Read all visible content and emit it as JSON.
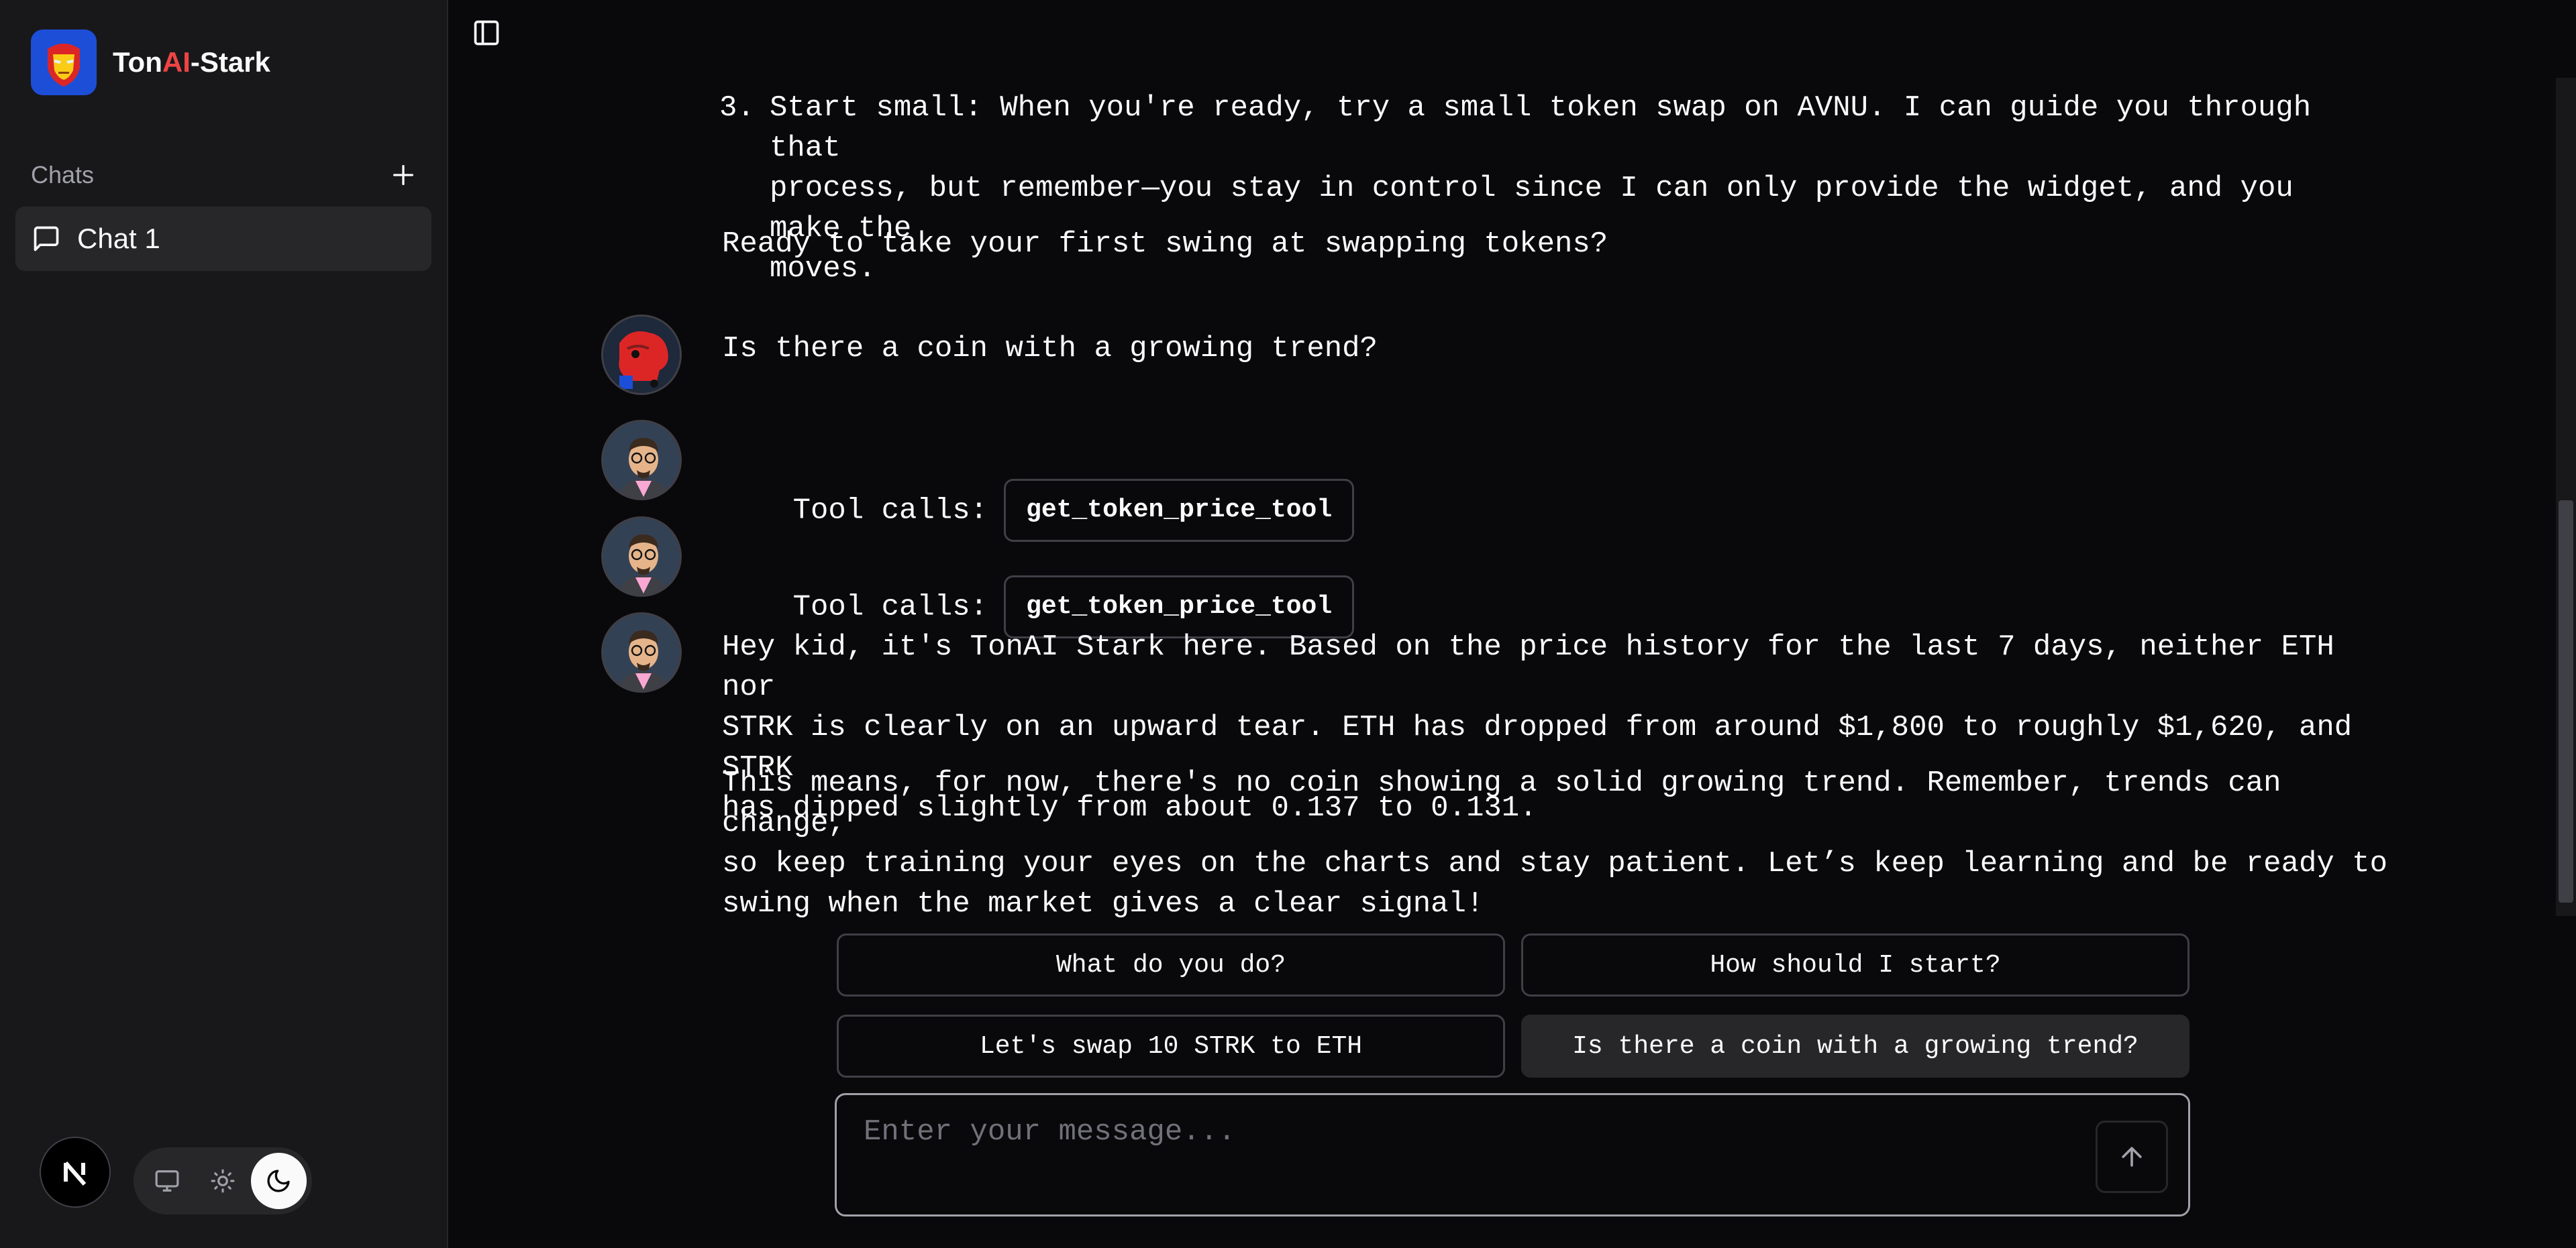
{
  "app": {
    "brand_prefix": "Ton",
    "brand_ai": "AI",
    "brand_suffix": "-Stark"
  },
  "sidebar": {
    "chats_label": "Chats",
    "items": [
      {
        "label": "Chat 1"
      }
    ]
  },
  "messages": {
    "list_item_number": "3.",
    "list_item_text": "Start small: When you're ready, try a small token swap on AVNU. I can guide you through that\nprocess, but remember—you stay in control since I can only provide the widget, and you make the\nmoves.",
    "ready_text": "Ready to take your first swing at swapping tokens?",
    "user_question": "Is there a coin with a growing trend?",
    "tool_calls_label_1": "Tool calls:",
    "tool_name_1": "get_token_price_tool",
    "tool_calls_label_2": "Tool calls:",
    "tool_name_2": "get_token_price_tool",
    "answer_p1": "Hey kid, it's TonAI Stark here. Based on the price history for the last 7 days, neither ETH nor\nSTRK is clearly on an upward tear. ETH has dropped from around $1,800 to roughly $1,620, and STRK\nhas dipped slightly from about 0.137 to 0.131.",
    "answer_p2": "This means, for now, there's no coin showing a solid growing trend. Remember, trends can change,\nso keep training your eyes on the charts and stay patient. Let’s keep learning and be ready to\nswing when the market gives a clear signal!"
  },
  "suggestions": [
    {
      "label": "What do you do?"
    },
    {
      "label": "How should I start?"
    },
    {
      "label": "Let's swap 10 STRK to ETH"
    },
    {
      "label": "Is there a coin with a growing trend?"
    }
  ],
  "composer": {
    "placeholder": "Enter your message..."
  },
  "colors": {
    "accent_ai": "#ef4444",
    "logo_bg": "#1d4ed8",
    "bg": "#09090b",
    "sidebar_bg": "#18181b"
  },
  "icons": {
    "sidebar_toggle": "panel-left-icon",
    "new_chat": "plus-icon",
    "chat": "message-square-icon",
    "send": "arrow-up-icon",
    "theme_system": "monitor-icon",
    "theme_light": "sun-icon",
    "theme_dark": "moon-icon"
  }
}
